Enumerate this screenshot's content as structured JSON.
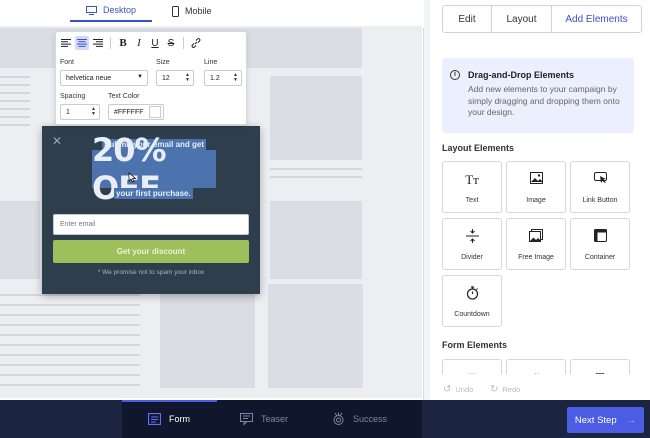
{
  "device_tabs": [
    {
      "label": "Desktop",
      "icon": "monitor-icon",
      "active": true
    },
    {
      "label": "Mobile",
      "icon": "phone-icon",
      "active": false
    }
  ],
  "toolbar": {
    "format_buttons": [
      "align-left-icon",
      "align-center-icon",
      "align-right-icon",
      "bold-icon",
      "italic-icon",
      "underline-icon",
      "strikethrough-icon",
      "link-icon"
    ],
    "font_label": "Font",
    "font_value": "helvetica neue",
    "size_label": "Size",
    "size_value": "12",
    "line_label": "Line",
    "line_value": "1.2",
    "spacing_label": "Spacing",
    "spacing_value": "1",
    "text_color_label": "Text Color",
    "text_color_value": "#FFFFFF"
  },
  "popup": {
    "line1": "Submit your email and get",
    "headline": "20% OFF",
    "line3": "your first purchase.",
    "email_placeholder": "Enter email",
    "cta_label": "Get your discount",
    "disclaimer": "* We promise not to spam your inbox",
    "bg_color": "#2f3e4d",
    "cta_color": "#9ebf5c"
  },
  "right_tabs": [
    {
      "label": "Edit",
      "active": false
    },
    {
      "label": "Layout",
      "active": false
    },
    {
      "label": "Add Elements",
      "active": true
    }
  ],
  "info": {
    "title": "Drag-and-Drop Elements",
    "description": "Add new elements to your campaign by simply dragging and dropping them onto your design."
  },
  "layout_section_title": "Layout Elements",
  "layout_elements": [
    {
      "label": "Text",
      "icon": "text-icon"
    },
    {
      "label": "Image",
      "icon": "image-icon"
    },
    {
      "label": "Link Button",
      "icon": "link-button-icon"
    },
    {
      "label": "Divider",
      "icon": "divider-icon"
    },
    {
      "label": "Free Image",
      "icon": "free-image-icon"
    },
    {
      "label": "Container",
      "icon": "container-icon"
    },
    {
      "label": "Countdown",
      "icon": "stopwatch-icon"
    }
  ],
  "form_section_title": "Form Elements",
  "undo_label": "Undo",
  "redo_label": "Redo",
  "steps": [
    {
      "label": "Form",
      "icon": "form-icon",
      "active": true
    },
    {
      "label": "Teaser",
      "icon": "teaser-icon",
      "active": false
    },
    {
      "label": "Success",
      "icon": "success-badge-icon",
      "active": false
    }
  ],
  "next_label": "Next Step",
  "accent_color": "#4b5de3"
}
